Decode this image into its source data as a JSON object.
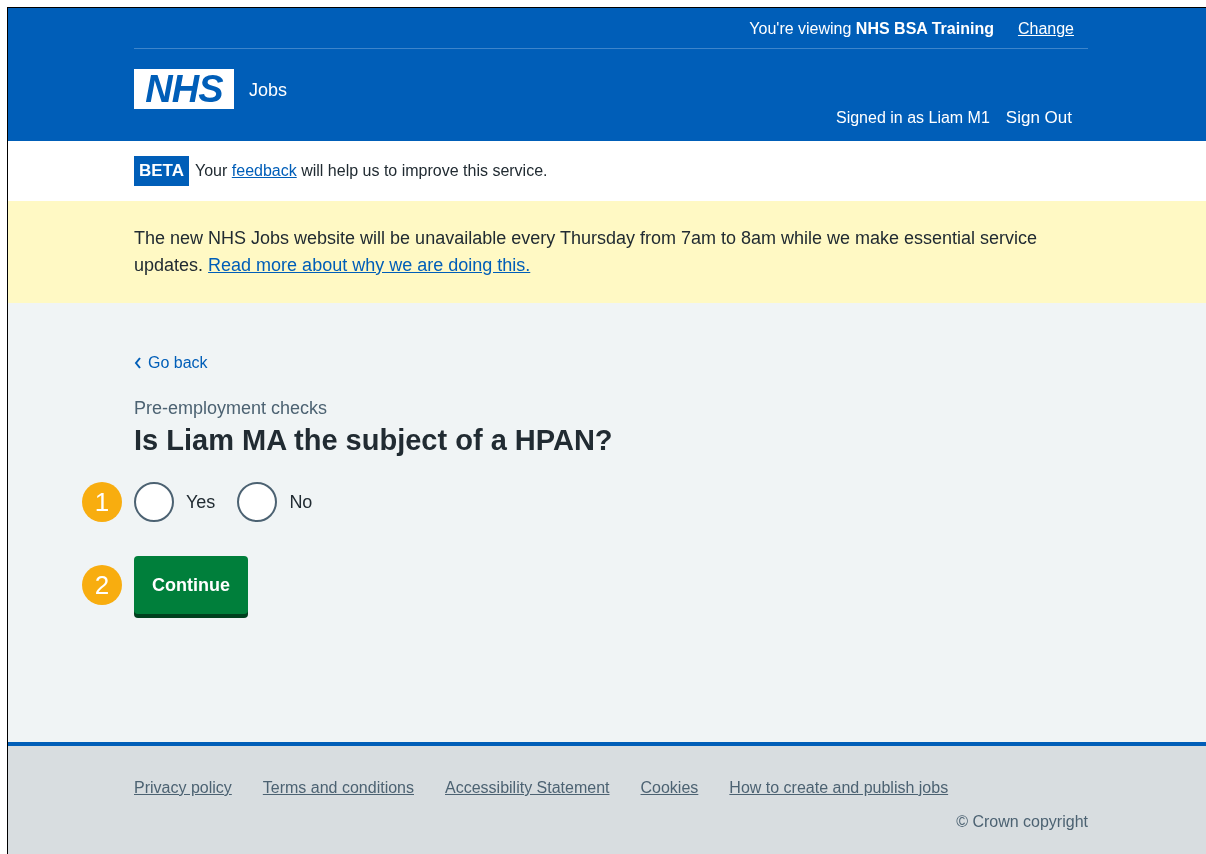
{
  "header": {
    "viewing": "You're viewing **NHS BSA Training**",
    "change_link": "Change",
    "logo": "NHS",
    "service": "Jobs",
    "signed_in": "Signed in as Liam M1",
    "sign_out": "Sign Out"
  },
  "beta": {
    "tag": "BETA",
    "before": "Your",
    "link": "feedback",
    "after": "will help us to improve this service."
  },
  "banner": {
    "text": "The new NHS Jobs website will be unavailable every Thursday from 7am to 8am while we make essential service updates.",
    "link": "Read more about why we are doing this."
  },
  "main": {
    "back_link": "Go back",
    "caption": "Pre-employment checks",
    "question": "Is Liam MA the subject of a HPAN?",
    "options_marker": "1",
    "options": [
      {
        "label": "Yes",
        "selected": false
      },
      {
        "label": "No",
        "selected": false
      }
    ],
    "continue_marker": "2",
    "continue_button": "Continue"
  },
  "footer": {
    "links": [
      "Privacy policy",
      "Terms and conditions",
      "Accessibility Statement",
      "Cookies",
      "How to create and publish jobs"
    ],
    "copyright": "© Crown copyright"
  }
}
